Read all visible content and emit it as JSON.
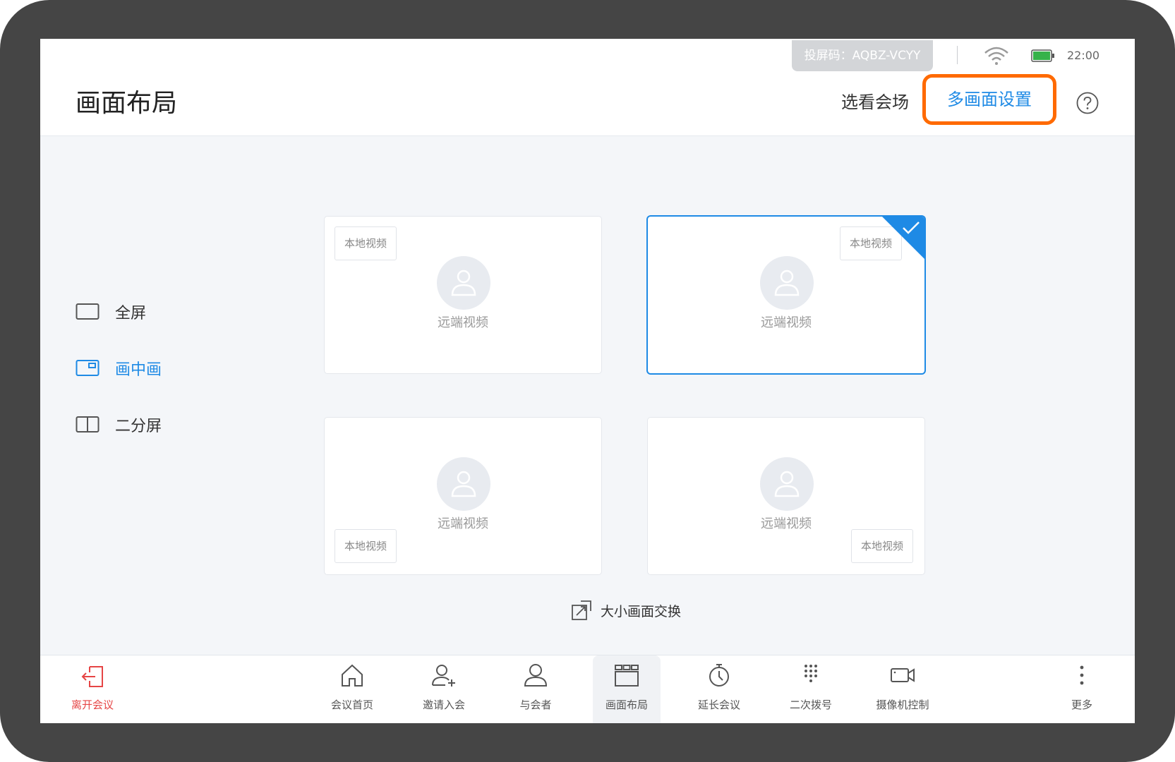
{
  "status_bar": {
    "cast_code": "投屏码：AQBZ-VCYY",
    "time": "22:00",
    "wifi_icon": "wifi-icon",
    "battery_icon": "battery-icon",
    "battery_color": "#36b24a"
  },
  "header": {
    "title": "画面布局",
    "view_conference": "选看会场",
    "multi_screen_settings": "多画面设置",
    "help_icon": "question-circle-icon",
    "highlight_color": "#ff6a00"
  },
  "layouts": [
    {
      "label": "全屏",
      "icon": "fullscreen-icon",
      "active": false
    },
    {
      "label": "画中画",
      "icon": "picture-in-picture-icon",
      "active": true
    },
    {
      "label": "二分屏",
      "icon": "split-screen-icon",
      "active": false
    }
  ],
  "cards": [
    {
      "remote": "远端视频",
      "local": "本地视频",
      "selected": false
    },
    {
      "remote": "远端视频",
      "local": "本地视频",
      "selected": true
    },
    {
      "remote": "远端视频",
      "local": "本地视频",
      "selected": false
    },
    {
      "remote": "远端视频",
      "local": "本地视频",
      "selected": false
    }
  ],
  "swap_label": "大小画面交换",
  "toolbar": {
    "items": [
      {
        "label": "离开会议",
        "icon": "exit-icon"
      },
      {
        "label": "会议首页",
        "icon": "home-icon"
      },
      {
        "label": "邀请入会",
        "icon": "invite-user-icon"
      },
      {
        "label": "与会者",
        "icon": "participants-icon"
      },
      {
        "label": "画面布局",
        "icon": "layout-icon"
      },
      {
        "label": "延长会议",
        "icon": "timer-icon"
      },
      {
        "label": "二次拨号",
        "icon": "dialpad-icon"
      },
      {
        "label": "摄像机控制",
        "icon": "camera-icon"
      },
      {
        "label": "更多",
        "icon": "more-vertical-icon"
      }
    ]
  },
  "colors": {
    "accent": "#1e8ae5",
    "leave": "#e64545"
  }
}
